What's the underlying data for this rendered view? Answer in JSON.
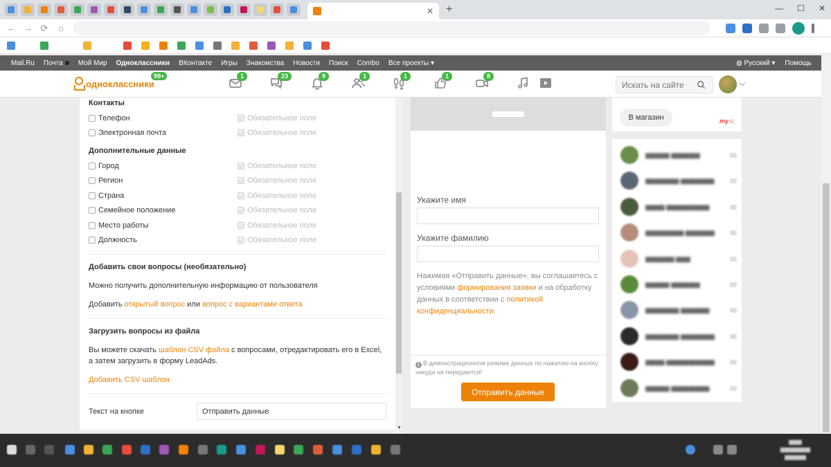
{
  "portal": {
    "items": [
      "Mail.Ru",
      "Почта",
      "Мой Мир",
      "Одноклассники",
      "ВКонтакте",
      "Игры",
      "Знакомства",
      "Новости",
      "Поиск",
      "Combo",
      "Все проекты ▾"
    ],
    "lang": "Русский ▾",
    "help": "Помощь"
  },
  "ok": {
    "logo_text": "одноклассники",
    "logo_badge": "99+",
    "badges": [
      "1",
      "23",
      "9",
      "1",
      "1",
      "1",
      "8"
    ],
    "search_placeholder": "Искать на сайте"
  },
  "form": {
    "contacts_title": "Контакты",
    "contacts": [
      "Телефон",
      "Электронная почта"
    ],
    "extra_title": "Дополнительные данные",
    "extra": [
      "Город",
      "Регион",
      "Страна",
      "Семейное положение",
      "Место работы",
      "Должность"
    ],
    "required_label": "Обязательное поле",
    "questions_title": "Добавить свои вопросы (необязательно)",
    "questions_desc": "Можно получить дополнительную информацию от пользователя",
    "add_prefix": "Добавить ",
    "open_q": "открытый вопрос",
    "or": " или ",
    "choice_q": "вопрос с вариантами ответа",
    "upload_title": "Загрузить вопросы из файла",
    "upload_text1": "Вы можете скачать ",
    "upload_link": "шаблон CSV файла",
    "upload_text2": " с вопросами, отредактировать его в Excel, а затем загрузить в форму LeadAds.",
    "add_csv": "Добавить CSV шаблон",
    "button_text_label": "Текст на кнопке",
    "button_text_value": "Отправить данные"
  },
  "preview": {
    "first_name_label": "Укажите имя",
    "last_name_label": "Укажите фамилию",
    "consent_1": "Нажимая «Отправить данные», вы соглашаетесь с условиями ",
    "consent_link1": "формирования заявки",
    "consent_2": " и на обработку данных в соответствии с ",
    "consent_link2": "политикой конфиденциальности",
    "consent_3": ".",
    "demo_note": "В демонстрационном режиме данные по нажатию на кнопку никуда не передаются!",
    "submit": "Отправить данные"
  },
  "shop": {
    "button": "В магазин"
  }
}
